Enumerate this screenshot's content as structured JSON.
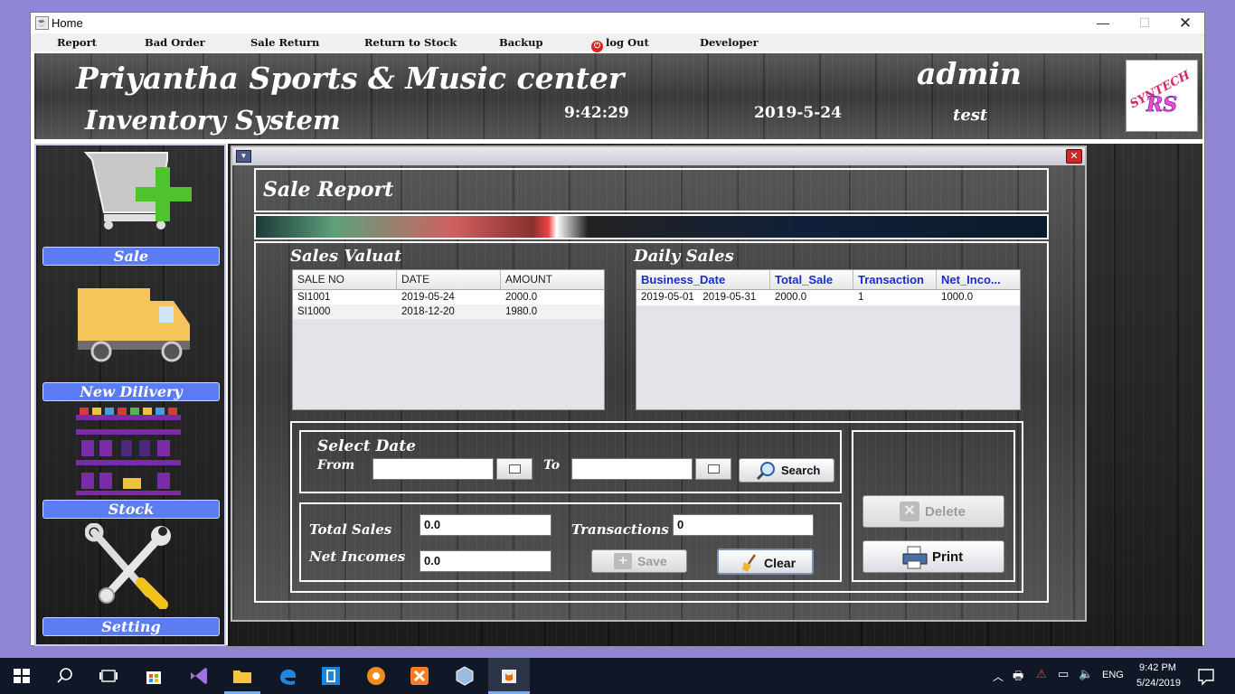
{
  "window": {
    "title": "Home"
  },
  "menu": [
    "Report",
    "Bad Order",
    "Sale Return",
    "Return to Stock",
    "Backup",
    "log Out",
    "Developer"
  ],
  "header": {
    "company": "Priyantha Sports & Music center",
    "system": "Inventory System",
    "time": "9:42:29",
    "date": "2019-5-24",
    "user": "admin",
    "user_sub": "test",
    "logo_top": "SYNTECH",
    "logo_bottom": "RS"
  },
  "sidebar": {
    "items": [
      {
        "label": "Sale",
        "icon": "cart-add-icon"
      },
      {
        "label": "New Dilivery",
        "icon": "delivery-truck-icon"
      },
      {
        "label": "Stock",
        "icon": "shelf-icon"
      },
      {
        "label": "Setting",
        "icon": "tools-icon"
      }
    ]
  },
  "report": {
    "title": "Sale Report",
    "sales": {
      "title": "Sales Valuat",
      "columns": [
        "SALE NO",
        "DATE",
        "AMOUNT"
      ],
      "rows": [
        [
          "SI1001",
          "2019-05-24",
          "2000.0"
        ],
        [
          "SI1000",
          "2018-12-20",
          "1980.0"
        ]
      ]
    },
    "daily": {
      "title": "Daily Sales",
      "columns": [
        "Business_Date",
        "Total_Sale",
        "Transaction",
        "Net_Inco..."
      ],
      "rows": [
        [
          "2019-05-01   2019-05-31",
          "2000.0",
          "1",
          "1000.0"
        ]
      ]
    },
    "select_date": {
      "title": "Select Date",
      "from_label": "From",
      "to_label": "To",
      "from_value": "",
      "to_value": "",
      "search": "Search"
    },
    "totals": {
      "total_sales_label": "Total Sales",
      "total_sales": "0.0",
      "net_incomes_label": "Net Incomes",
      "net_incomes": "0.0",
      "transactions_label": "Transactions",
      "transactions": "0",
      "save": "Save",
      "clear": "Clear"
    },
    "actions": {
      "delete": "Delete",
      "print": "Print"
    }
  },
  "taskbar": {
    "lang": "ENG",
    "time": "9:42 PM",
    "date": "5/24/2019"
  },
  "colors": {
    "accent": "#5b7cf2",
    "table_header_text": "#1a2cc9",
    "close": "#c62a2a"
  }
}
